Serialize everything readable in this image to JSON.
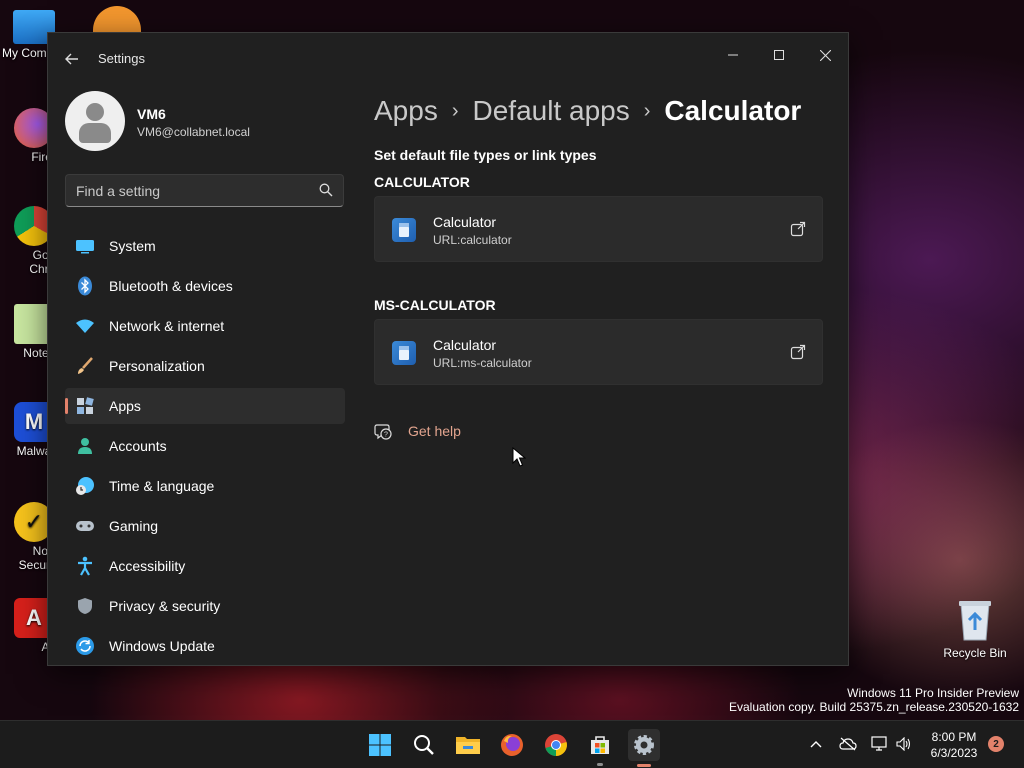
{
  "desktop": {
    "icons": [
      {
        "label": "My Com",
        "icon": "computer-icon"
      },
      {
        "label": "Firefo",
        "icon": "firefox-icon"
      },
      {
        "label": "Goog Chron",
        "icon": "chrome-icon"
      },
      {
        "label": "Notepa",
        "icon": "notepad-icon"
      },
      {
        "label": "Malware",
        "icon": "malwarebytes-icon"
      },
      {
        "label": "Norto Security",
        "icon": "norton-icon"
      },
      {
        "label": "Avir",
        "icon": "avira-icon"
      }
    ],
    "recycle_bin": "Recycle Bin",
    "watermark_line1": "Windows 11 Pro Insider Preview",
    "watermark_line2": "Evaluation copy. Build 25375.zn_release.230520-1632"
  },
  "window": {
    "title": "Settings",
    "controls": {
      "minimize": "—",
      "maximize": "☐",
      "close": "✕"
    }
  },
  "profile": {
    "name": "VM6",
    "email": "VM6@collabnet.local"
  },
  "search": {
    "placeholder": "Find a setting"
  },
  "nav": {
    "items": [
      {
        "label": "System",
        "icon": "system-icon",
        "active": false
      },
      {
        "label": "Bluetooth & devices",
        "icon": "bluetooth-icon",
        "active": false
      },
      {
        "label": "Network & internet",
        "icon": "network-icon",
        "active": false
      },
      {
        "label": "Personalization",
        "icon": "brush-icon",
        "active": false
      },
      {
        "label": "Apps",
        "icon": "apps-icon",
        "active": true
      },
      {
        "label": "Accounts",
        "icon": "accounts-icon",
        "active": false
      },
      {
        "label": "Time & language",
        "icon": "time-language-icon",
        "active": false
      },
      {
        "label": "Gaming",
        "icon": "gaming-icon",
        "active": false
      },
      {
        "label": "Accessibility",
        "icon": "accessibility-icon",
        "active": false
      },
      {
        "label": "Privacy & security",
        "icon": "shield-icon",
        "active": false
      },
      {
        "label": "Windows Update",
        "icon": "windows-update-icon",
        "active": false
      }
    ]
  },
  "breadcrumb": {
    "items": [
      "Apps",
      "Default apps"
    ],
    "current": "Calculator",
    "separator": "›"
  },
  "main": {
    "subtitle": "Set default file types or link types",
    "sections": [
      {
        "heading": "CALCULATOR",
        "app_name": "Calculator",
        "url": "URL:calculator"
      },
      {
        "heading": "MS-CALCULATOR",
        "app_name": "Calculator",
        "url": "URL:ms-calculator"
      }
    ],
    "help": "Get help"
  },
  "taskbar": {
    "apps": [
      "start-icon",
      "search-icon",
      "file-explorer-icon",
      "firefox-icon",
      "chrome-icon",
      "store-icon",
      "settings-icon"
    ],
    "clock_time": "8:00 PM",
    "clock_date": "6/3/2023",
    "notification_count": "2"
  },
  "colors": {
    "accent": "#e3826b",
    "window_bg": "#202020",
    "card_bg": "#2b2b2b",
    "link": "#e3a58f"
  }
}
